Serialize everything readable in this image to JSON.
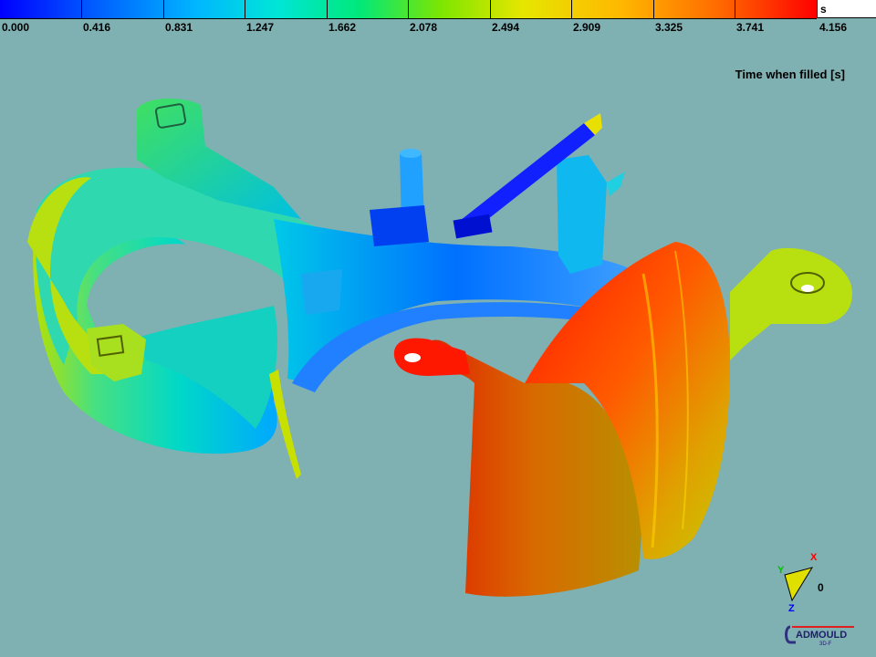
{
  "colorbar": {
    "ticks": [
      "0.000",
      "0.416",
      "0.831",
      "1.247",
      "1.662",
      "2.078",
      "2.494",
      "2.909",
      "3.325",
      "3.741",
      "4.156"
    ],
    "unit": "s",
    "gradient_colors": [
      "#0000ff",
      "#00b6ff",
      "#00e87a",
      "#e6e600",
      "#ff6a00",
      "#ff0000"
    ]
  },
  "result_title": "Time when filled [s]",
  "axis_triad": {
    "x_label": "X",
    "y_label": "Y",
    "z_label": "Z",
    "zero_label": "0"
  },
  "logo": {
    "text": "ADMOULD",
    "subtext": "3D-F"
  },
  "colors": {
    "background": "#7fb0b2",
    "hot": "#ff2000",
    "cold": "#0000ff"
  }
}
